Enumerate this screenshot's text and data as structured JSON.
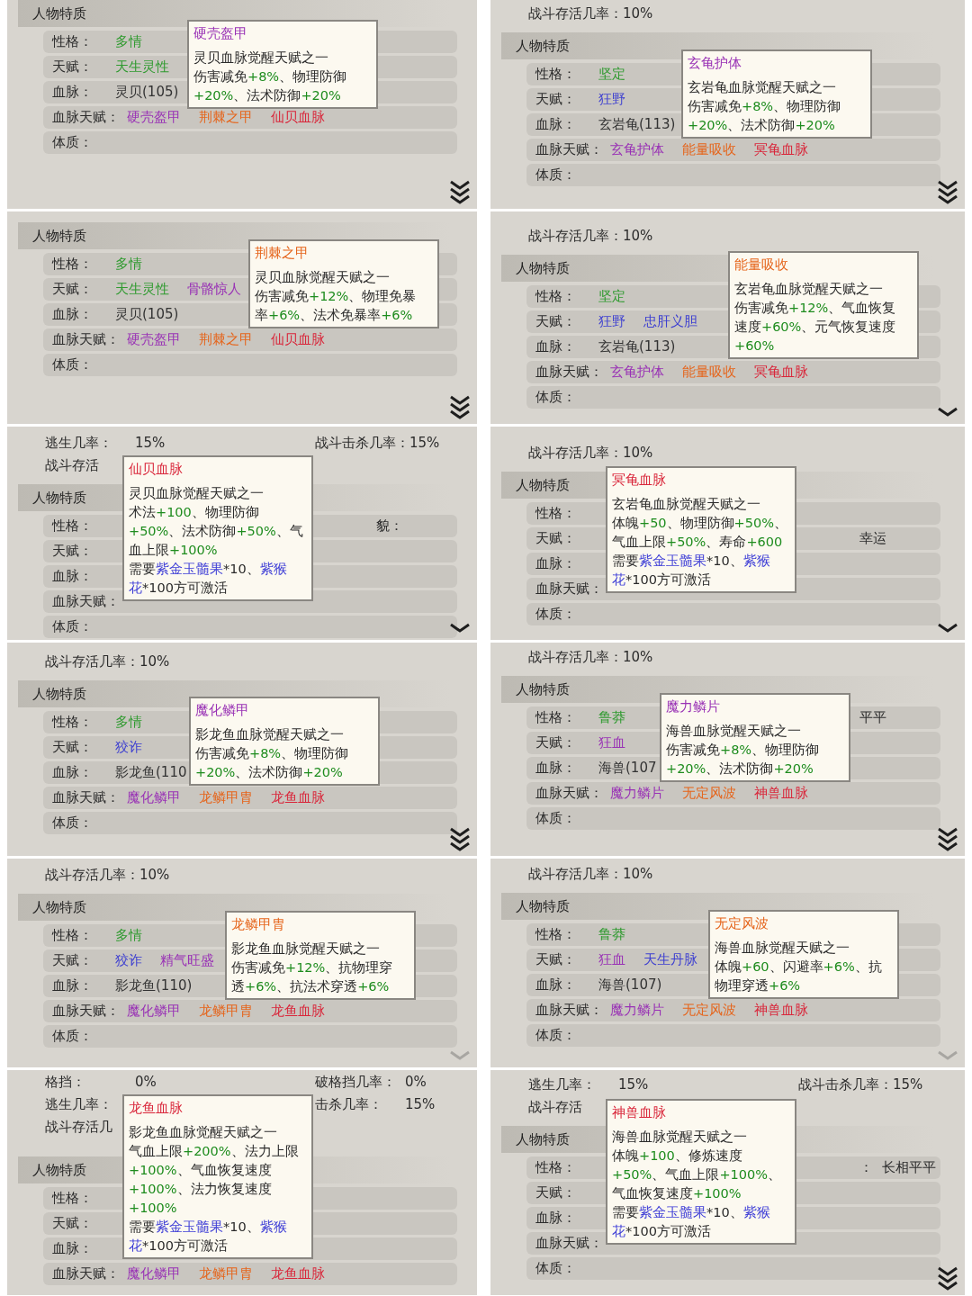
{
  "panels": [
    {
      "section_title": "人物特质",
      "rows": [
        {
          "label": "性格：",
          "values": [
            {
              "text": "多情",
              "color": "#2f9a2f"
            }
          ]
        },
        {
          "label": "天赋：",
          "values": [
            {
              "text": "天生灵性",
              "color": "#2f9a2f"
            }
          ]
        },
        {
          "label": "血脉：",
          "values": [
            {
              "text": "灵贝(105)",
              "color": "#333333"
            }
          ]
        },
        {
          "label": "血脉天赋：",
          "values": [
            {
              "text": "硬壳盔甲",
              "color": "#9932b5"
            },
            {
              "text": "荆棘之甲",
              "color": "#e5651c"
            },
            {
              "text": "仙贝血脉",
              "color": "#d9263a"
            }
          ]
        },
        {
          "label": "体质：",
          "values": []
        }
      ],
      "tooltip": {
        "title": "硬壳盔甲",
        "color": "#9932b5",
        "lines": [
          [
            {
              "text": "灵贝血脉觉醒天赋之一",
              "kind": "text"
            }
          ],
          [
            {
              "text": "伤害减免",
              "kind": "text"
            },
            {
              "text": "+8%",
              "kind": "bonus"
            },
            {
              "text": "、物理防御",
              "kind": "text"
            }
          ],
          [
            {
              "text": "+20%",
              "kind": "bonus"
            },
            {
              "text": "、法术防御",
              "kind": "text"
            },
            {
              "text": "+20%",
              "kind": "bonus"
            }
          ]
        ]
      },
      "chevron": {
        "kind": "double",
        "dimmed": false
      }
    },
    {
      "stat_lines": [
        [
          {
            "label": "战斗存活几率：",
            "value": "10%"
          }
        ]
      ],
      "section_title": "人物特质",
      "rows": [
        {
          "label": "性格：",
          "values": [
            {
              "text": "坚定",
              "color": "#2f9a2f"
            }
          ]
        },
        {
          "label": "天赋：",
          "values": [
            {
              "text": "狂野",
              "color": "#3d3fd0"
            }
          ]
        },
        {
          "label": "血脉：",
          "values": [
            {
              "text": "玄岩龟(113)",
              "color": "#333333"
            }
          ]
        },
        {
          "label": "血脉天赋：",
          "values": [
            {
              "text": "玄龟护体",
              "color": "#9932b5"
            },
            {
              "text": "能量吸收",
              "color": "#e5651c"
            },
            {
              "text": "冥龟血脉",
              "color": "#d9263a"
            }
          ]
        },
        {
          "label": "体质：",
          "values": []
        }
      ],
      "tooltip": {
        "title": "玄龟护体",
        "color": "#9932b5",
        "lines": [
          [
            {
              "text": "玄岩龟血脉觉醒天赋之一",
              "kind": "text"
            }
          ],
          [
            {
              "text": "伤害减免",
              "kind": "text"
            },
            {
              "text": "+8%",
              "kind": "bonus"
            },
            {
              "text": "、物理防御",
              "kind": "text"
            }
          ],
          [
            {
              "text": "+20%",
              "kind": "bonus"
            },
            {
              "text": "、法术防御",
              "kind": "text"
            },
            {
              "text": "+20%",
              "kind": "bonus"
            }
          ]
        ]
      },
      "chevron": {
        "kind": "double",
        "dimmed": false
      }
    },
    {
      "section_title": "人物特质",
      "rows": [
        {
          "label": "性格：",
          "values": [
            {
              "text": "多情",
              "color": "#2f9a2f"
            }
          ]
        },
        {
          "label": "天赋：",
          "values": [
            {
              "text": "天生灵性",
              "color": "#2f9a2f"
            },
            {
              "text": "骨骼惊人",
              "color": "#9932b5"
            }
          ]
        },
        {
          "label": "血脉：",
          "values": [
            {
              "text": "灵贝(105)",
              "color": "#333333"
            }
          ]
        },
        {
          "label": "血脉天赋：",
          "values": [
            {
              "text": "硬壳盔甲",
              "color": "#9932b5"
            },
            {
              "text": "荆棘之甲",
              "color": "#e5651c"
            },
            {
              "text": "仙贝血脉",
              "color": "#d9263a"
            }
          ]
        },
        {
          "label": "体质：",
          "values": []
        }
      ],
      "tooltip": {
        "title": "荆棘之甲",
        "color": "#e5651c",
        "lines": [
          [
            {
              "text": "灵贝血脉觉醒天赋之一",
              "kind": "text"
            }
          ],
          [
            {
              "text": "伤害减免",
              "kind": "text"
            },
            {
              "text": "+12%",
              "kind": "bonus"
            },
            {
              "text": "、物理免暴",
              "kind": "text"
            }
          ],
          [
            {
              "text": "率",
              "kind": "text"
            },
            {
              "text": "+6%",
              "kind": "bonus"
            },
            {
              "text": "、法术免暴率",
              "kind": "text"
            },
            {
              "text": "+6%",
              "kind": "bonus"
            }
          ]
        ]
      },
      "chevron": {
        "kind": "double",
        "dimmed": false
      }
    },
    {
      "stat_lines": [
        [
          {
            "label": "战斗存活几率：",
            "value": "10%"
          }
        ]
      ],
      "section_title": "人物特质",
      "rows": [
        {
          "label": "性格：",
          "values": [
            {
              "text": "坚定",
              "color": "#2f9a2f"
            }
          ]
        },
        {
          "label": "天赋：",
          "values": [
            {
              "text": "狂野",
              "color": "#3d3fd0"
            },
            {
              "text": "忠肝义胆",
              "color": "#3d3fd0"
            }
          ]
        },
        {
          "label": "血脉：",
          "values": [
            {
              "text": "玄岩龟(113)",
              "color": "#333333"
            }
          ]
        },
        {
          "label": "血脉天赋：",
          "values": [
            {
              "text": "玄龟护体",
              "color": "#9932b5"
            },
            {
              "text": "能量吸收",
              "color": "#e5651c"
            },
            {
              "text": "冥龟血脉",
              "color": "#d9263a"
            }
          ]
        },
        {
          "label": "体质：",
          "values": []
        }
      ],
      "tooltip": {
        "title": "能量吸收",
        "color": "#e5651c",
        "lines": [
          [
            {
              "text": "玄岩龟血脉觉醒天赋之一",
              "kind": "text"
            }
          ],
          [
            {
              "text": "伤害减免",
              "kind": "text"
            },
            {
              "text": "+12%",
              "kind": "bonus"
            },
            {
              "text": "、气血恢复",
              "kind": "text"
            }
          ],
          [
            {
              "text": "速度",
              "kind": "text"
            },
            {
              "text": "+60%",
              "kind": "bonus"
            },
            {
              "text": "、元气恢复速度",
              "kind": "text"
            }
          ],
          [
            {
              "text": "+60%",
              "kind": "bonus"
            }
          ]
        ]
      },
      "chevron": {
        "kind": "single",
        "dimmed": false
      }
    },
    {
      "stat_lines": [
        [
          {
            "label": "逃生几率：",
            "value": "15%"
          },
          {
            "label": "战斗击杀几率：",
            "value": "15%"
          }
        ],
        [
          {
            "label": "战斗存活"
          }
        ]
      ],
      "section_title": "人物特质",
      "rows": [
        {
          "label": "性格：",
          "values": [],
          "right": "貌："
        },
        {
          "label": "天赋：",
          "values": []
        },
        {
          "label": "血脉：",
          "values": []
        },
        {
          "label": "血脉天赋：",
          "values": []
        },
        {
          "label": "体质：",
          "values": []
        }
      ],
      "tooltip": {
        "title": "仙贝血脉",
        "color": "#d9263a",
        "lines": [
          [
            {
              "text": "灵贝血脉觉醒天赋之一",
              "kind": "text"
            }
          ],
          [
            {
              "text": "术法",
              "kind": "text"
            },
            {
              "text": "+100",
              "kind": "bonus"
            },
            {
              "text": "、物理防御",
              "kind": "text"
            }
          ],
          [
            {
              "text": "+50%",
              "kind": "bonus"
            },
            {
              "text": "、法术防御",
              "kind": "text"
            },
            {
              "text": "+50%",
              "kind": "bonus"
            },
            {
              "text": "、气",
              "kind": "text"
            }
          ],
          [
            {
              "text": "血上限",
              "kind": "text"
            },
            {
              "text": "+100%",
              "kind": "bonus"
            }
          ],
          [
            {
              "text": "需要",
              "kind": "text"
            },
            {
              "text": "紫金玉髓果",
              "kind": "item"
            },
            {
              "text": "*10、",
              "kind": "text"
            },
            {
              "text": "紫猴",
              "kind": "item"
            }
          ],
          [
            {
              "text": "花",
              "kind": "item"
            },
            {
              "text": "*100方可激活",
              "kind": "text"
            }
          ]
        ]
      },
      "chevron": {
        "kind": "single",
        "dimmed": false
      }
    },
    {
      "stat_lines": [
        [
          {
            "label": "战斗存活几率：",
            "value": "10%"
          }
        ]
      ],
      "section_title": "人物特质",
      "rows": [
        {
          "label": "性格：",
          "values": []
        },
        {
          "label": "天赋：",
          "values": [],
          "right": "幸运"
        },
        {
          "label": "血脉：",
          "values": []
        },
        {
          "label": "血脉天赋：",
          "values": []
        },
        {
          "label": "体质：",
          "values": []
        }
      ],
      "tooltip": {
        "title": "冥龟血脉",
        "color": "#d9263a",
        "lines": [
          [
            {
              "text": "玄岩龟血脉觉醒天赋之一",
              "kind": "text"
            }
          ],
          [
            {
              "text": "体魄",
              "kind": "text"
            },
            {
              "text": "+50",
              "kind": "bonus"
            },
            {
              "text": "、物理防御",
              "kind": "text"
            },
            {
              "text": "+50%",
              "kind": "bonus"
            },
            {
              "text": "、",
              "kind": "text"
            }
          ],
          [
            {
              "text": "气血上限",
              "kind": "text"
            },
            {
              "text": "+50%",
              "kind": "bonus"
            },
            {
              "text": "、寿命",
              "kind": "text"
            },
            {
              "text": "+600",
              "kind": "bonus"
            }
          ],
          [
            {
              "text": "需要",
              "kind": "text"
            },
            {
              "text": "紫金玉髓果",
              "kind": "item"
            },
            {
              "text": "*10、",
              "kind": "text"
            },
            {
              "text": "紫猴",
              "kind": "item"
            }
          ],
          [
            {
              "text": "花",
              "kind": "item"
            },
            {
              "text": "*100方可激活",
              "kind": "text"
            }
          ]
        ]
      },
      "chevron": {
        "kind": "single",
        "dimmed": false
      }
    },
    {
      "stat_lines": [
        [
          {
            "label": "战斗存活几率：",
            "value": "10%"
          }
        ]
      ],
      "section_title": "人物特质",
      "rows": [
        {
          "label": "性格：",
          "values": [
            {
              "text": "多情",
              "color": "#2f9a2f"
            }
          ]
        },
        {
          "label": "天赋：",
          "values": [
            {
              "text": "狡诈",
              "color": "#3d3fd0"
            }
          ]
        },
        {
          "label": "血脉：",
          "values": [
            {
              "text": "影龙鱼(110",
              "color": "#333333"
            }
          ]
        },
        {
          "label": "血脉天赋：",
          "values": [
            {
              "text": "魔化鳞甲",
              "color": "#9932b5"
            },
            {
              "text": "龙鳞甲胄",
              "color": "#e5651c"
            },
            {
              "text": "龙鱼血脉",
              "color": "#d9263a"
            }
          ]
        },
        {
          "label": "体质：",
          "values": []
        }
      ],
      "tooltip": {
        "title": "魔化鳞甲",
        "color": "#9932b5",
        "lines": [
          [
            {
              "text": "影龙鱼血脉觉醒天赋之一",
              "kind": "text"
            }
          ],
          [
            {
              "text": "伤害减免",
              "kind": "text"
            },
            {
              "text": "+8%",
              "kind": "bonus"
            },
            {
              "text": "、物理防御",
              "kind": "text"
            }
          ],
          [
            {
              "text": "+20%",
              "kind": "bonus"
            },
            {
              "text": "、法术防御",
              "kind": "text"
            },
            {
              "text": "+20%",
              "kind": "bonus"
            }
          ]
        ]
      },
      "chevron": {
        "kind": "double",
        "dimmed": false
      }
    },
    {
      "stat_lines": [
        [
          {
            "label": "战斗存活几率：",
            "value": "10%"
          }
        ]
      ],
      "section_title": "人物特质",
      "rows": [
        {
          "label": "性格：",
          "values": [
            {
              "text": "鲁莽",
              "color": "#2f9a2f"
            }
          ],
          "right": "平平"
        },
        {
          "label": "天赋：",
          "values": [
            {
              "text": "狂血",
              "color": "#9932b5"
            }
          ]
        },
        {
          "label": "血脉：",
          "values": [
            {
              "text": "海兽(107",
              "color": "#333333"
            }
          ]
        },
        {
          "label": "血脉天赋：",
          "values": [
            {
              "text": "魔力鳞片",
              "color": "#9932b5"
            },
            {
              "text": "无定风波",
              "color": "#e5651c"
            },
            {
              "text": "神兽血脉",
              "color": "#d9263a"
            }
          ]
        },
        {
          "label": "体质：",
          "values": []
        }
      ],
      "tooltip": {
        "title": "魔力鳞片",
        "color": "#9932b5",
        "lines": [
          [
            {
              "text": "海兽血脉觉醒天赋之一",
              "kind": "text"
            }
          ],
          [
            {
              "text": "伤害减免",
              "kind": "text"
            },
            {
              "text": "+8%",
              "kind": "bonus"
            },
            {
              "text": "、物理防御",
              "kind": "text"
            }
          ],
          [
            {
              "text": "+20%",
              "kind": "bonus"
            },
            {
              "text": "、法术防御",
              "kind": "text"
            },
            {
              "text": "+20%",
              "kind": "bonus"
            }
          ]
        ]
      },
      "chevron": {
        "kind": "double",
        "dimmed": false
      }
    },
    {
      "stat_lines": [
        [
          {
            "label": "战斗存活几率：",
            "value": "10%"
          }
        ]
      ],
      "section_title": "人物特质",
      "rows": [
        {
          "label": "性格：",
          "values": [
            {
              "text": "多情",
              "color": "#2f9a2f"
            }
          ]
        },
        {
          "label": "天赋：",
          "values": [
            {
              "text": "狡诈",
              "color": "#3d3fd0"
            },
            {
              "text": "精气旺盛",
              "color": "#9932b5"
            }
          ]
        },
        {
          "label": "血脉：",
          "values": [
            {
              "text": "影龙鱼(110)",
              "color": "#333333"
            }
          ]
        },
        {
          "label": "血脉天赋：",
          "values": [
            {
              "text": "魔化鳞甲",
              "color": "#9932b5"
            },
            {
              "text": "龙鳞甲胄",
              "color": "#e5651c"
            },
            {
              "text": "龙鱼血脉",
              "color": "#d9263a"
            }
          ]
        },
        {
          "label": "体质：",
          "values": []
        }
      ],
      "tooltip": {
        "title": "龙鳞甲胄",
        "color": "#e5651c",
        "lines": [
          [
            {
              "text": "影龙鱼血脉觉醒天赋之一",
              "kind": "text"
            }
          ],
          [
            {
              "text": "伤害减免",
              "kind": "text"
            },
            {
              "text": "+12%",
              "kind": "bonus"
            },
            {
              "text": "、抗物理穿",
              "kind": "text"
            }
          ],
          [
            {
              "text": "透",
              "kind": "text"
            },
            {
              "text": "+6%",
              "kind": "bonus"
            },
            {
              "text": "、抗法术穿透",
              "kind": "text"
            },
            {
              "text": "+6%",
              "kind": "bonus"
            }
          ]
        ]
      },
      "chevron": {
        "kind": "single",
        "dimmed": true
      }
    },
    {
      "stat_lines": [
        [
          {
            "label": "战斗存活几率：",
            "value": "10%"
          }
        ]
      ],
      "section_title": "人物特质",
      "rows": [
        {
          "label": "性格：",
          "values": [
            {
              "text": "鲁莽",
              "color": "#2f9a2f"
            }
          ]
        },
        {
          "label": "天赋：",
          "values": [
            {
              "text": "狂血",
              "color": "#9932b5"
            },
            {
              "text": "天生丹脉",
              "color": "#3d3fd0"
            }
          ]
        },
        {
          "label": "血脉：",
          "values": [
            {
              "text": "海兽(107)",
              "color": "#333333"
            }
          ]
        },
        {
          "label": "血脉天赋：",
          "values": [
            {
              "text": "魔力鳞片",
              "color": "#9932b5"
            },
            {
              "text": "无定风波",
              "color": "#e5651c"
            },
            {
              "text": "神兽血脉",
              "color": "#d9263a"
            }
          ]
        },
        {
          "label": "体质：",
          "values": []
        }
      ],
      "tooltip": {
        "title": "无定风波",
        "color": "#e5651c",
        "lines": [
          [
            {
              "text": "海兽血脉觉醒天赋之一",
              "kind": "text"
            }
          ],
          [
            {
              "text": "体魄",
              "kind": "text"
            },
            {
              "text": "+60",
              "kind": "bonus"
            },
            {
              "text": "、闪避率",
              "kind": "text"
            },
            {
              "text": "+6%",
              "kind": "bonus"
            },
            {
              "text": "、抗",
              "kind": "text"
            }
          ],
          [
            {
              "text": "物理穿透",
              "kind": "text"
            },
            {
              "text": "+6%",
              "kind": "bonus"
            }
          ]
        ]
      },
      "chevron": {
        "kind": "single",
        "dimmed": true
      }
    },
    {
      "stat_lines": [
        [
          {
            "label": "格挡：",
            "value": "0%"
          },
          {
            "label": "破格挡几率：",
            "value": "0%"
          }
        ],
        [
          {
            "label": "逃生几率："
          },
          {
            "label": "击杀几率：",
            "value": "15%"
          }
        ],
        [
          {
            "label": "战斗存活几"
          }
        ]
      ],
      "section_title": "人物特质",
      "rows": [
        {
          "label": "性格：",
          "values": []
        },
        {
          "label": "天赋：",
          "values": []
        },
        {
          "label": "血脉：",
          "values": []
        },
        {
          "label": "血脉天赋：",
          "values": [
            {
              "text": "魔化鳞甲",
              "color": "#9932b5"
            },
            {
              "text": "龙鳞甲胄",
              "color": "#e5651c"
            },
            {
              "text": "龙鱼血脉",
              "color": "#d9263a"
            }
          ]
        }
      ],
      "tooltip": {
        "title": "龙鱼血脉",
        "color": "#d9263a",
        "lines": [
          [
            {
              "text": "影龙鱼血脉觉醒天赋之一",
              "kind": "text"
            }
          ],
          [
            {
              "text": "气血上限",
              "kind": "text"
            },
            {
              "text": "+200%",
              "kind": "bonus"
            },
            {
              "text": "、法力上限",
              "kind": "text"
            }
          ],
          [
            {
              "text": "+100%",
              "kind": "bonus"
            },
            {
              "text": "、气血恢复速度",
              "kind": "text"
            }
          ],
          [
            {
              "text": "+100%",
              "kind": "bonus"
            },
            {
              "text": "、法力恢复速度",
              "kind": "text"
            }
          ],
          [
            {
              "text": "+100%",
              "kind": "bonus"
            }
          ],
          [
            {
              "text": "需要",
              "kind": "text"
            },
            {
              "text": "紫金玉髓果",
              "kind": "item"
            },
            {
              "text": "*10、",
              "kind": "text"
            },
            {
              "text": "紫猴",
              "kind": "item"
            }
          ],
          [
            {
              "text": "花",
              "kind": "item"
            },
            {
              "text": "*100方可激活",
              "kind": "text"
            }
          ]
        ]
      }
    },
    {
      "stat_lines": [
        [
          {
            "label": "逃生几率：",
            "value": "15%"
          },
          {
            "label": "战斗击杀几率：",
            "value": "15%"
          }
        ],
        [
          {
            "label": "战斗存活"
          }
        ]
      ],
      "section_title": "人物特质",
      "rows": [
        {
          "label": "性格：",
          "values": [],
          "right": "：  长相平平"
        },
        {
          "label": "天赋：",
          "values": []
        },
        {
          "label": "血脉：",
          "values": []
        },
        {
          "label": "血脉天赋：",
          "values": []
        },
        {
          "label": "体质：",
          "values": []
        }
      ],
      "tooltip": {
        "title": "神兽血脉",
        "color": "#d9263a",
        "lines": [
          [
            {
              "text": "海兽血脉觉醒天赋之一",
              "kind": "text"
            }
          ],
          [
            {
              "text": "体魄",
              "kind": "text"
            },
            {
              "text": "+100",
              "kind": "bonus"
            },
            {
              "text": "、修炼速度",
              "kind": "text"
            }
          ],
          [
            {
              "text": "+50%",
              "kind": "bonus"
            },
            {
              "text": "、气血上限",
              "kind": "text"
            },
            {
              "text": "+100%",
              "kind": "bonus"
            },
            {
              "text": "、",
              "kind": "text"
            }
          ],
          [
            {
              "text": "气血恢复速度",
              "kind": "text"
            },
            {
              "text": "+100%",
              "kind": "bonus"
            }
          ],
          [
            {
              "text": "需要",
              "kind": "text"
            },
            {
              "text": "紫金玉髓果",
              "kind": "item"
            },
            {
              "text": "*10、",
              "kind": "text"
            },
            {
              "text": "紫猴",
              "kind": "item"
            }
          ],
          [
            {
              "text": "花",
              "kind": "item"
            },
            {
              "text": "*100方可激活",
              "kind": "text"
            }
          ]
        ]
      },
      "chevron": {
        "kind": "double",
        "dimmed": false
      }
    }
  ]
}
